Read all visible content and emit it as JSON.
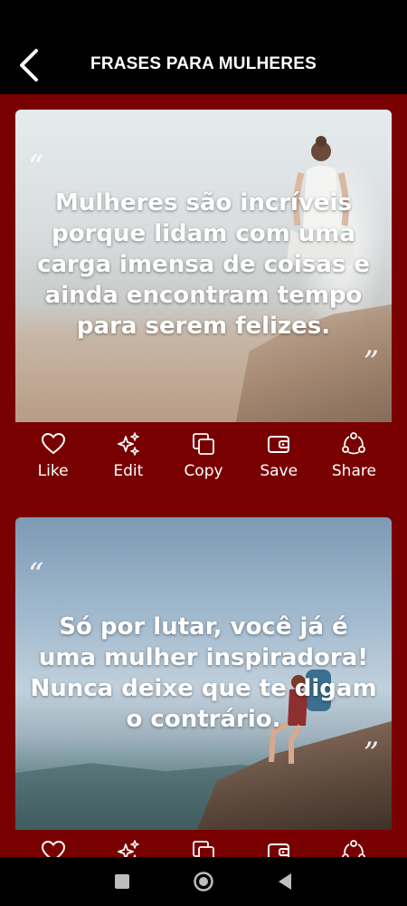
{
  "header": {
    "title": "FRASES PARA MULHERES",
    "back_icon": "chevron-left-icon"
  },
  "colors": {
    "background": "#780000",
    "topbar": "#000000",
    "text": "#ffffff"
  },
  "cards": [
    {
      "quote": "Mulheres são incríveis porque lidam com uma carga imensa de coisas e ainda encontram tempo para serem felizes.",
      "quote_open": "“",
      "quote_close": "”"
    },
    {
      "quote": "Só por lutar, você já é uma mulher inspiradora! Nunca deixe que te digam o contrário.",
      "quote_open": "“",
      "quote_close": "”"
    }
  ],
  "actions": [
    {
      "label": "Like",
      "icon": "heart-icon"
    },
    {
      "label": "Edit",
      "icon": "sparkles-icon"
    },
    {
      "label": "Copy",
      "icon": "copy-icon"
    },
    {
      "label": "Save",
      "icon": "wallet-icon"
    },
    {
      "label": "Share",
      "icon": "share-nodes-icon"
    }
  ],
  "system_nav": [
    {
      "icon": "recents-square-icon"
    },
    {
      "icon": "home-circle-icon"
    },
    {
      "icon": "back-triangle-icon"
    }
  ]
}
